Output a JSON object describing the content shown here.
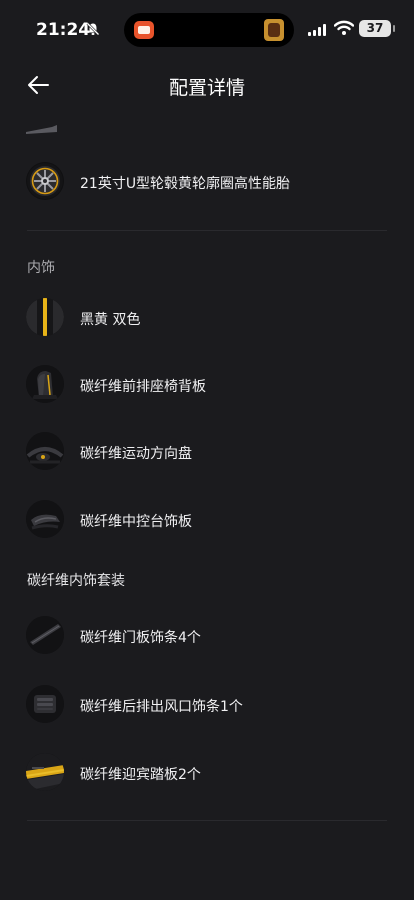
{
  "status_bar": {
    "time": "21:24",
    "battery": "37"
  },
  "header": {
    "title": "配置详情"
  },
  "wheels": {
    "items": [
      {
        "label": "21英寸U型轮毂黄轮廓圈高性能胎"
      }
    ]
  },
  "interior": {
    "title": "内饰",
    "items": [
      {
        "label": "黑黄 双色"
      },
      {
        "label": "碳纤维前排座椅背板"
      },
      {
        "label": "碳纤维运动方向盘"
      },
      {
        "label": "碳纤维中控台饰板"
      }
    ]
  },
  "carbon_package": {
    "title": "碳纤维内饰套装",
    "items": [
      {
        "label": "碳纤维门板饰条4个"
      },
      {
        "label": "碳纤维后排出风口饰条1个"
      },
      {
        "label": "碳纤维迎宾踏板2个"
      }
    ]
  },
  "colors": {
    "background": "#1b1b1e",
    "accent_yellow": "#e8b418",
    "divider": "#2a2a2e"
  }
}
